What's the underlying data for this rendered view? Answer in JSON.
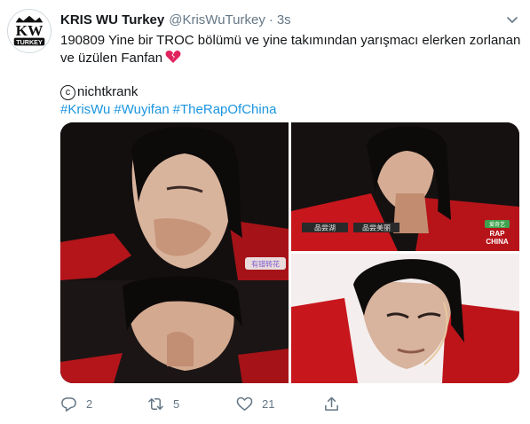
{
  "user": {
    "display_name": "KRIS WU Turkey",
    "handle": "@KrisWuTurkey",
    "time": "3s",
    "avatar_text_top": "KW",
    "avatar_text_bottom": "TURKEY"
  },
  "tweet": {
    "line1": "190809 Yine bir TROC bölümü ve yine takımından yarışmacı elerken zorlanan",
    "line2": "ve üzülen Fanfan",
    "credit_symbol": "c",
    "credit": "nichtkrank",
    "hashtags": [
      "#KrisWu",
      "#Wuyifan",
      "#TheRapOfChina"
    ]
  },
  "media": {
    "caption_left": "品尝湖",
    "caption_right": "品尝美丽",
    "badge": "爱奇艺",
    "logo_top": "RAP",
    "logo_bottom": "CHINA",
    "sticker": "有错转花"
  },
  "actions": {
    "reply_count": "2",
    "retweet_count": "5",
    "like_count": "21"
  },
  "colors": {
    "link": "#1b95e0",
    "secondary_text": "#657786",
    "jacket_red": "#c8161d",
    "broken_heart": "#e0245e"
  },
  "icons": [
    "caret-down-icon",
    "broken-heart-icon",
    "reply-icon",
    "retweet-icon",
    "like-icon",
    "share-icon"
  ]
}
